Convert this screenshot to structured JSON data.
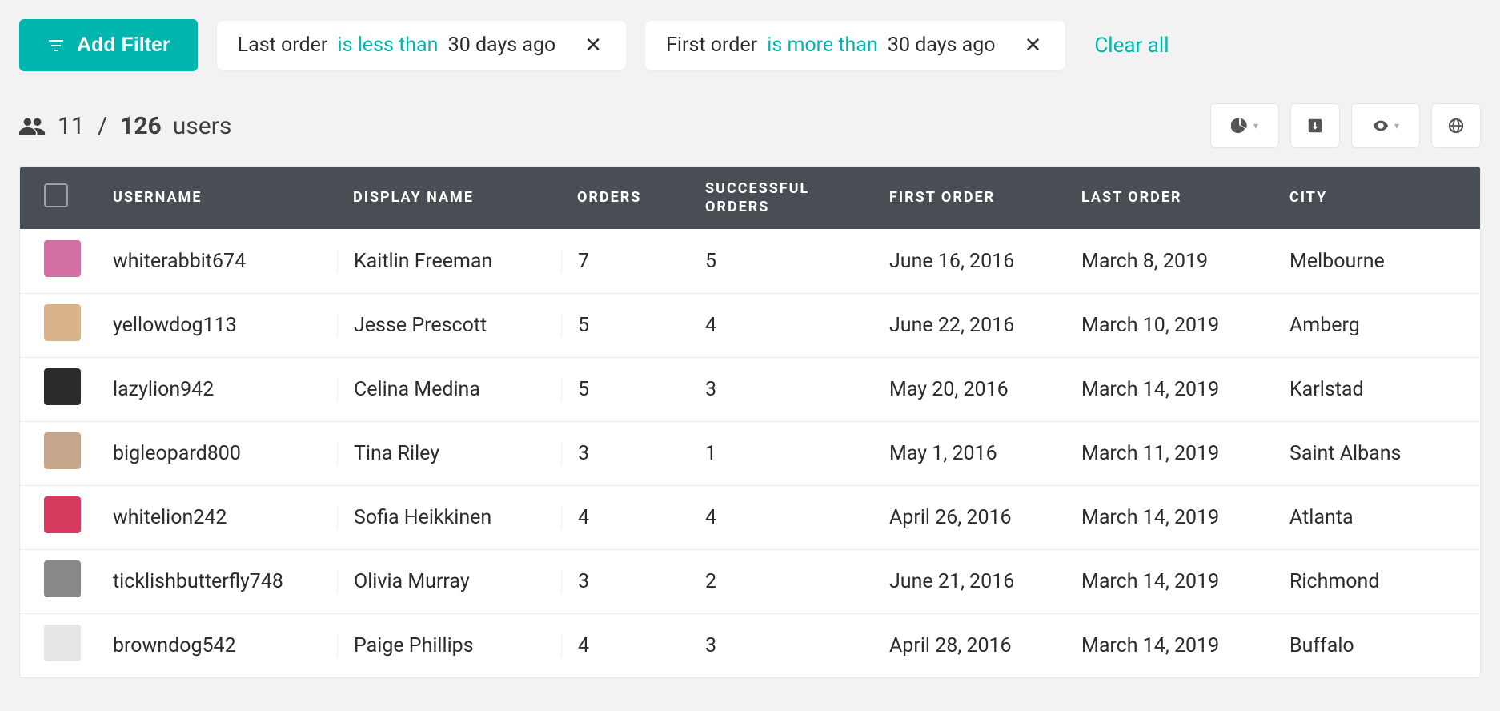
{
  "toolbar": {
    "add_filter_label": "Add Filter",
    "clear_all_label": "Clear all",
    "chips": [
      {
        "field": "Last order",
        "op": "is less than",
        "value": "30 days ago"
      },
      {
        "field": "First order",
        "op": "is more than",
        "value": "30 days ago"
      }
    ]
  },
  "summary": {
    "filtered": "11",
    "separator": "/",
    "total": "126",
    "noun": "users"
  },
  "table": {
    "headers": {
      "username": "USERNAME",
      "display_name": "DISPLAY NAME",
      "orders": "ORDERS",
      "successful_orders": "SUCCESSFUL ORDERS",
      "first_order": "FIRST ORDER",
      "last_order": "LAST ORDER",
      "city": "CITY"
    },
    "rows": [
      {
        "avatar_color": "#d46fa3",
        "username": "whiterabbit674",
        "display_name": "Kaitlin Freeman",
        "orders": "7",
        "successful_orders": "5",
        "first_order": "June 16, 2016",
        "last_order": "March 8, 2019",
        "city": "Melbourne"
      },
      {
        "avatar_color": "#d9b38c",
        "username": "yellowdog113",
        "display_name": "Jesse Prescott",
        "orders": "5",
        "successful_orders": "4",
        "first_order": "June 22, 2016",
        "last_order": "March 10, 2019",
        "city": "Amberg"
      },
      {
        "avatar_color": "#2b2b2b",
        "username": "lazylion942",
        "display_name": "Celina Medina",
        "orders": "5",
        "successful_orders": "3",
        "first_order": "May 20, 2016",
        "last_order": "March 14, 2019",
        "city": "Karlstad"
      },
      {
        "avatar_color": "#c7a58a",
        "username": "bigleopard800",
        "display_name": "Tina Riley",
        "orders": "3",
        "successful_orders": "1",
        "first_order": "May 1, 2016",
        "last_order": "March 11, 2019",
        "city": "Saint Albans"
      },
      {
        "avatar_color": "#d63a5f",
        "username": "whitelion242",
        "display_name": "Sofia Heikkinen",
        "orders": "4",
        "successful_orders": "4",
        "first_order": "April 26, 2016",
        "last_order": "March 14, 2019",
        "city": "Atlanta"
      },
      {
        "avatar_color": "#888888",
        "username": "ticklishbutterfly748",
        "display_name": "Olivia Murray",
        "orders": "3",
        "successful_orders": "2",
        "first_order": "June 21, 2016",
        "last_order": "March 14, 2019",
        "city": "Richmond"
      },
      {
        "avatar_color": "#e6e6e6",
        "username": "browndog542",
        "display_name": "Paige Phillips",
        "orders": "4",
        "successful_orders": "3",
        "first_order": "April 28, 2016",
        "last_order": "March 14, 2019",
        "city": "Buffalo"
      }
    ]
  }
}
